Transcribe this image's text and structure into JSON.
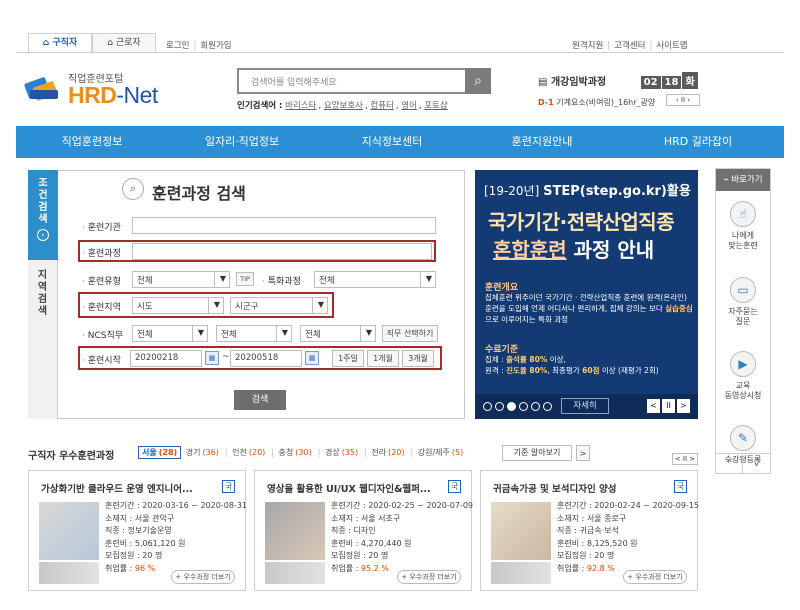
{
  "top": {
    "tab_jobseeker": "구직자",
    "tab_worker": "근로자",
    "login": "로그인",
    "signup": "회원가입",
    "right_links": [
      "원격지원",
      "고객센터",
      "사이트맵"
    ]
  },
  "logo": {
    "sub": "직업훈련포털",
    "main_hrd": "HRD",
    "main_net": "-Net"
  },
  "search": {
    "placeholder": "검색어를 입력해주세요",
    "popular_label": "인기검색어 :",
    "popular_terms": [
      "바리스타",
      "요양보호사",
      "컴퓨터",
      "영어",
      "포토샵"
    ]
  },
  "countdown": {
    "title": "개강임박과정",
    "month": "02",
    "day": "18",
    "weekday": "화",
    "dday": "D-1",
    "course": "기계요소(비여링)_16hr_광양"
  },
  "nav": [
    "직업훈련정보",
    "일자리·직업정보",
    "지식정보센터",
    "훈련지원안내",
    "HRD 길라잡이"
  ],
  "panel": {
    "tab1": [
      "조",
      "건",
      "검",
      "색"
    ],
    "tab2": [
      "지",
      "역",
      "검",
      "색"
    ],
    "title": "훈련과정 검색",
    "labels": {
      "institution": "훈련기관",
      "course": "훈련과정",
      "type": "훈련유형",
      "special": "특화과정",
      "region": "훈련지역",
      "ncs": "NCS직무",
      "start": "훈련시작"
    },
    "type_value": "전체",
    "tip": "TIP",
    "special_value": "전체",
    "region_city": "시도",
    "region_district": "시군구",
    "ncs_values": [
      "전체",
      "전체",
      "전체"
    ],
    "ncs_button": "직무 선택하기",
    "start_from": "20200218",
    "start_to": "20200518",
    "range_sep": "~",
    "period_buttons": [
      "1주일",
      "1개월",
      "3개월"
    ],
    "search_button": "검색"
  },
  "banner": {
    "top_prefix": "[19-20년]",
    "top_main": "STEP(step.go.kr)활용",
    "main1": "국가기간·전략산업직종",
    "main2_hl": "혼합훈련",
    "main2_rest": "과정 안내",
    "h1": "훈련개요",
    "t1_a": "집체훈련 위주이던 국가기간 · 전략산업직종 훈련에 원격(온라인) 훈련을 도입해 언제 어디서나 편리하게, 집체 강의는 보다 ",
    "t1_b": "실습중심",
    "t1_c": "으로 이루어지는 특화 과정",
    "h2": "수료기준",
    "t2_a": "집체 : ",
    "t2_b": "출석률 80%",
    "t2_c": " 이상,",
    "t2_d": "원격 : ",
    "t2_e": "진도율 80%",
    "t2_f": ", 최종평가 ",
    "t2_g": "60점",
    "t2_h": " 이상 (재평가 2회)",
    "more": "자세히",
    "prev": "<",
    "pause": "II",
    "next": ">"
  },
  "quick": {
    "head": "바로가기",
    "items": [
      {
        "icon": "hand-icon",
        "label1": "나에게",
        "label2": "맞는훈련"
      },
      {
        "icon": "chat-icon",
        "label1": "자주묻는",
        "label2": "질문"
      },
      {
        "icon": "play-icon",
        "label1": "교육",
        "label2": "동영상시청"
      },
      {
        "icon": "pencil-icon",
        "label1": "수강평등록",
        "label2": ""
      }
    ],
    "up": "^",
    "down": "v"
  },
  "best": {
    "title_a": "구직자",
    "title_b": " 우수훈련과정",
    "regions": [
      {
        "name": "서울",
        "count": "(28)"
      },
      {
        "name": "경기",
        "count": "(36)"
      },
      {
        "name": "인천",
        "count": "(20)"
      },
      {
        "name": "충청",
        "count": "(30)"
      },
      {
        "name": "경상",
        "count": "(35)"
      },
      {
        "name": "전라",
        "count": "(20)"
      },
      {
        "name": "강원/제주",
        "count": "(5)"
      }
    ],
    "criteria": "기준 알아보기",
    "criteria_arrow": ">",
    "pager": "< II >",
    "cards": [
      {
        "title": "가상화기반 클라우드 운영 엔지니어...",
        "badge": "국",
        "period": "훈련기간 : 2020-03-16 ~ 2020-08-31",
        "location": "소재지 : 서울 관악구",
        "job": "직종 : 정보기술운영",
        "fee": "훈련비 : 5,061,120 원",
        "capacity": "모집정원 : 20 명",
        "employ_label": "취업률 : ",
        "employ": "96 %",
        "more": "+ 우수과정 더보기"
      },
      {
        "title": "영상을 활용한 UI/UX 웹디자인&웹퍼...",
        "badge": "국",
        "period": "훈련기간 : 2020-02-25 ~ 2020-07-09",
        "location": "소재지 : 서울 서초구",
        "job": "직종 : 디자인",
        "fee": "훈련비 : 4,270,440 원",
        "capacity": "모집정원 : 20 명",
        "employ_label": "취업률 : ",
        "employ": "95.2 %",
        "more": "+ 우수과정 더보기"
      },
      {
        "title": "귀금속가공 및 보석디자인 양성",
        "badge": "국",
        "period": "훈련기간 : 2020-02-24 ~ 2020-09-15",
        "location": "소재지 : 서울 종로구",
        "job": "직종 : 귀금속·보석",
        "fee": "훈련비 : 8,125,520 원",
        "capacity": "모집정원 : 20 명",
        "employ_label": "취업률 : ",
        "employ": "92.8 %",
        "more": "+ 우수과정 더보기"
      }
    ]
  }
}
